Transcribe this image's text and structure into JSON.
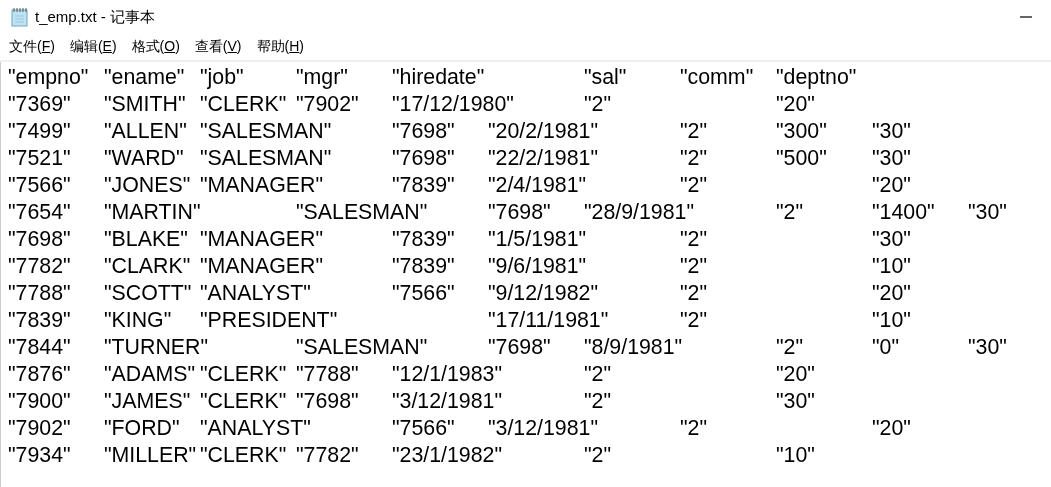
{
  "window": {
    "title": "t_emp.txt - 记事本"
  },
  "menu": [
    {
      "label": "文件(",
      "access_key": "F",
      "label_end": ")"
    },
    {
      "label": "编辑(",
      "access_key": "E",
      "label_end": ")"
    },
    {
      "label": "格式(",
      "access_key": "O",
      "label_end": ")"
    },
    {
      "label": "查看(",
      "access_key": "V",
      "label_end": ")"
    },
    {
      "label": "帮助(",
      "access_key": "H",
      "label_end": ")"
    }
  ],
  "editor": {
    "lines": [
      "\"empno\"\t\"ename\"\t\"job\"\t\"mgr\"\t\"hiredate\"\t\t\"sal\"\t\"comm\"\t\"deptno\"",
      "\"7369\"\t\"SMITH\"\t\"CLERK\"\t\"7902\"\t\"17/12/1980\"\t\"2\"\t\t\"20\"",
      "\"7499\"\t\"ALLEN\"\t\"SALESMAN\"\t\"7698\"\t\"20/2/1981\"\t\"2\"\t\"300\"\t\"30\"",
      "\"7521\"\t\"WARD\"\t\"SALESMAN\"\t\"7698\"\t\"22/2/1981\"\t\"2\"\t\"500\"\t\"30\"",
      "\"7566\"\t\"JONES\"\t\"MANAGER\"\t\"7839\"\t\"2/4/1981\"\t\"2\"\t\t\"20\"",
      "\"7654\"\t\"MARTIN\"\t\"SALESMAN\"\t\"7698\"\t\"28/9/1981\"\t\"2\"\t\"1400\"\t\"30\"",
      "\"7698\"\t\"BLAKE\"\t\"MANAGER\"\t\"7839\"\t\"1/5/1981\"\t\"2\"\t\t\"30\"",
      "\"7782\"\t\"CLARK\"\t\"MANAGER\"\t\"7839\"\t\"9/6/1981\"\t\"2\"\t\t\"10\"",
      "\"7788\"\t\"SCOTT\"\t\"ANALYST\"\t\"7566\"\t\"9/12/1982\"\t\"2\"\t\t\"20\"",
      "\"7839\"\t\"KING\"\t\"PRESIDENT\"\t\t\"17/11/1981\"\t\"2\"\t\t\"10\"",
      "\"7844\"\t\"TURNER\"\t\"SALESMAN\"\t\"7698\"\t\"8/9/1981\"\t\"2\"\t\"0\"\t\"30\"",
      "\"7876\"\t\"ADAMS\"\t\"CLERK\"\t\"7788\"\t\"12/1/1983\"\t\"2\"\t\t\"20\"",
      "\"7900\"\t\"JAMES\"\t\"CLERK\"\t\"7698\"\t\"3/12/1981\"\t\"2\"\t\t\"30\"",
      "\"7902\"\t\"FORD\"\t\"ANALYST\"\t\"7566\"\t\"3/12/1981\"\t\"2\"\t\t\"20\"",
      "\"7934\"\t\"MILLER\"\t\"CLERK\"\t\"7782\"\t\"23/1/1982\"\t\"2\"\t\t\"10\""
    ]
  }
}
